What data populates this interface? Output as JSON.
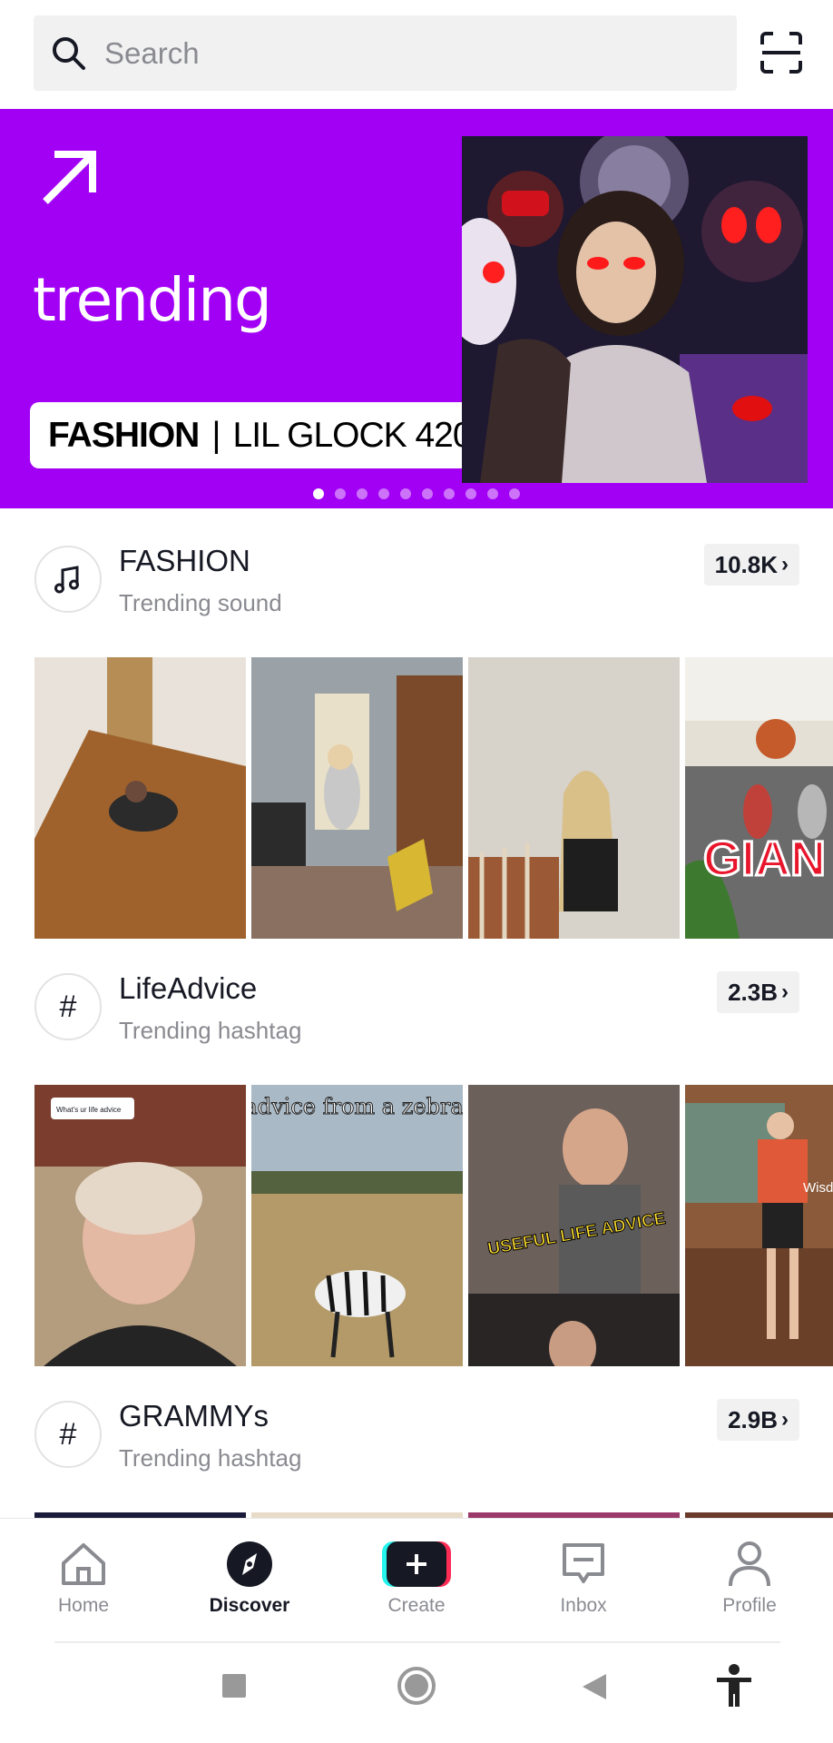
{
  "search": {
    "placeholder": "Search"
  },
  "banner": {
    "title": "trending",
    "pill_bold": "FASHION",
    "pill_separator": "|",
    "pill_rest": "LIL GLOCK 420",
    "background": "#a200f5",
    "dots_total": 10,
    "dots_active_index": 0
  },
  "sections": [
    {
      "title": "FASHION",
      "subtitle": "Trending sound",
      "count": "10.8K",
      "icon": "music-note-icon"
    },
    {
      "title": "LifeAdvice",
      "subtitle": "Trending hashtag",
      "count": "2.3B",
      "icon": "hashtag-icon",
      "overlay_texts": [
        "What's ur life advice",
        "life advice from a zebra calf",
        "USEFUL LIFE ADVICE",
        "Wisdom Wednesday"
      ]
    },
    {
      "title": "GRAMMYs",
      "subtitle": "Trending hashtag",
      "count": "2.9B",
      "icon": "hashtag-icon"
    }
  ],
  "fashion_thumb_text": "GIAN",
  "nav": {
    "items": [
      {
        "label": "Home",
        "icon": "home-icon"
      },
      {
        "label": "Discover",
        "icon": "compass-icon",
        "active": true
      },
      {
        "label": "Create",
        "icon": "plus-icon"
      },
      {
        "label": "Inbox",
        "icon": "inbox-icon"
      },
      {
        "label": "Profile",
        "icon": "profile-icon"
      }
    ]
  },
  "colors": {
    "accent": "#a200f5",
    "cyan": "#25f4ee",
    "red": "#fe2c55"
  }
}
